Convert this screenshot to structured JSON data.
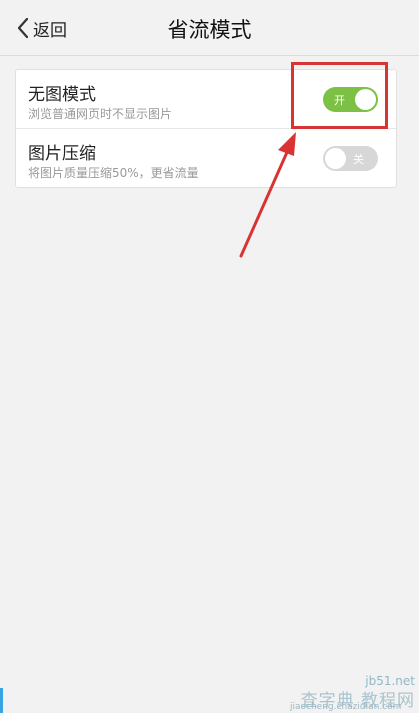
{
  "nav": {
    "back_label": "返回",
    "title": "省流模式"
  },
  "settings": [
    {
      "title": "无图模式",
      "subtitle": "浏览普通网页时不显示图片",
      "toggle_on": true,
      "toggle_text": "开"
    },
    {
      "title": "图片压缩",
      "subtitle": "将图片质量压缩50%，更省流量",
      "toggle_on": false,
      "toggle_text": "关"
    }
  ],
  "annotation": {
    "color": "#d83434"
  },
  "watermark": {
    "site": "jb51.net",
    "name": "查字典 教程网",
    "url": "jiaocheng.chazidian.com"
  },
  "colors": {
    "toggle_on": "#7cc045",
    "toggle_off": "#d7d7d7",
    "background": "#f2f2f2"
  }
}
